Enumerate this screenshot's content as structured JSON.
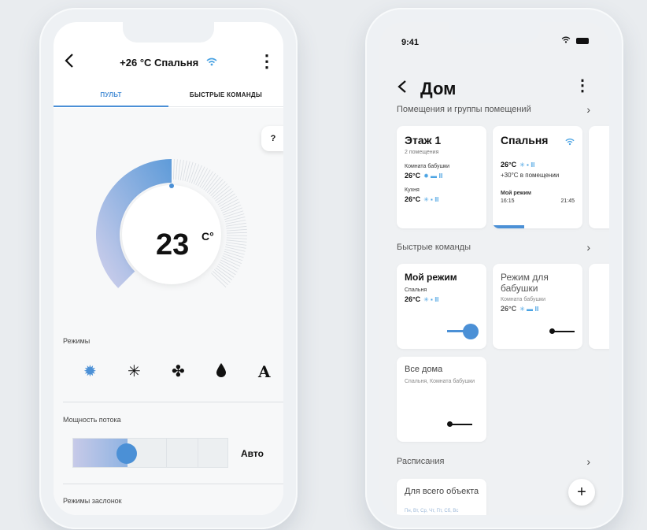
{
  "phone1": {
    "header": {
      "title": "+26 °C Спальня",
      "wifi_icon": "wifi-icon"
    },
    "tabs": [
      {
        "label": "ПУЛЬТ",
        "active": true
      },
      {
        "label": "БЫСТРЫЕ КОМАНДЫ",
        "active": false
      }
    ],
    "help_label": "?",
    "thermostat": {
      "temperature": "23",
      "unit": "C°",
      "setpoint_fraction": 0.5
    },
    "modes_label": "Режимы",
    "modes": [
      {
        "icon": "heat-icon",
        "glyph": "✹",
        "active": true
      },
      {
        "icon": "cool-icon",
        "glyph": "✳",
        "active": false
      },
      {
        "icon": "fan-icon",
        "glyph": "✤",
        "active": false
      },
      {
        "icon": "dry-icon",
        "glyph": "💧",
        "active": false
      },
      {
        "icon": "auto-icon",
        "glyph": "A",
        "active": false
      }
    ],
    "flow_label": "Мощность потока",
    "flow_value": "Авто",
    "flow_level_fraction": 0.35,
    "louvers_label": "Режимы заслонок",
    "accent_color": "#4b90d6"
  },
  "phone2": {
    "status": {
      "time": "9:41"
    },
    "title": "Дом",
    "sections": {
      "rooms": "Помещения и группы помещений",
      "quick": "Быстрые команды",
      "schedules": "Расписания"
    },
    "rooms": {
      "floor": {
        "title": "Этаж 1",
        "subtitle": "2 помещения",
        "room1": "Комната бабушки",
        "room1_temp": "26°C",
        "room2": "Кухня",
        "room2_temp": "26°C"
      },
      "bedroom": {
        "title": "Спальня",
        "temp": "26°C",
        "inside": "+30°C в помещении",
        "mode_label": "Мой режим",
        "time_start": "16:15",
        "time_end": "21:45"
      }
    },
    "quick": {
      "my_mode": {
        "title": "Мой режим",
        "room": "Спальня",
        "temp": "26°C",
        "on": true
      },
      "grandma": {
        "title": "Режим для бабушки",
        "room": "Комната бабушки",
        "temp": "26°C",
        "on": false
      },
      "all_home": {
        "title": "Все дома",
        "rooms": "Спальня, Комната бабушки",
        "on": false
      }
    },
    "schedule": {
      "title": "Для всего объекта",
      "days": "Пн, Вт, Ср, Чт, Пт, Сб, Вс"
    },
    "fab_label": "+"
  }
}
